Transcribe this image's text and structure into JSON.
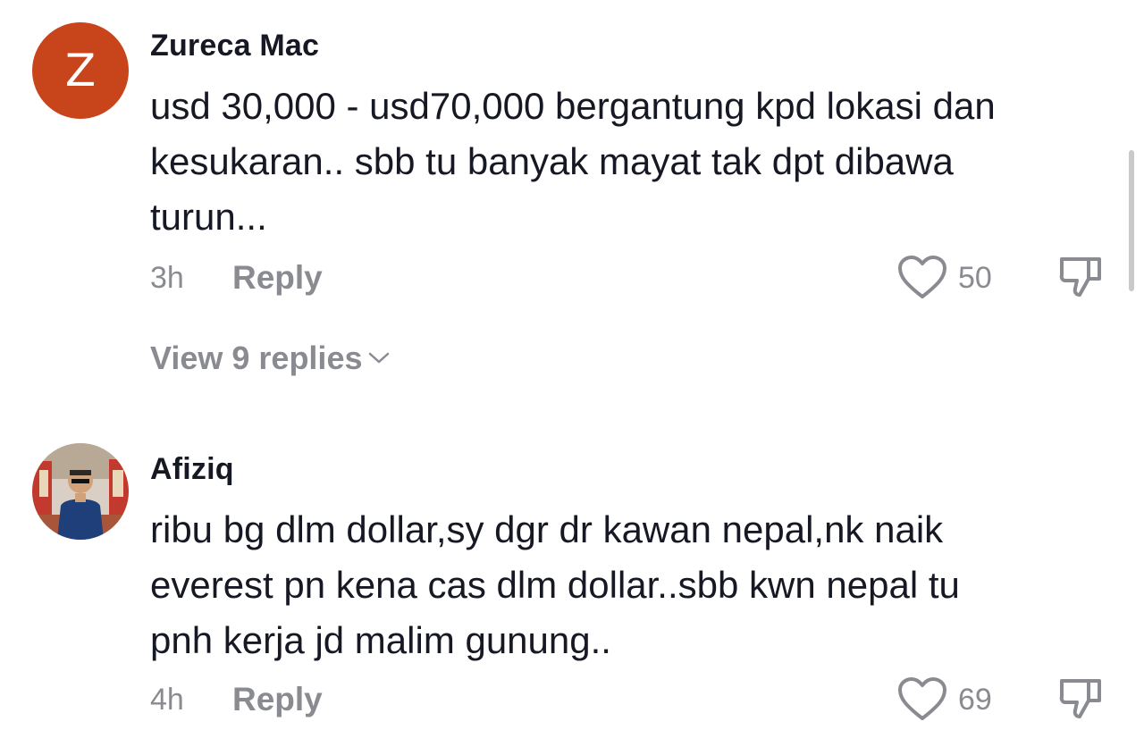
{
  "comments": [
    {
      "username": "Zureca Mac",
      "avatar_letter": "Z",
      "text": "usd 30,000 - usd70,000 bergantung kpd lokasi dan\nkesukaran.. sbb tu banyak mayat tak dpt dibawa\nturun...",
      "time": "3h",
      "reply_label": "Reply",
      "likes": "50",
      "view_replies": "View 9 replies"
    },
    {
      "username": "Afiziq",
      "avatar_icon": "profile-photo",
      "text": "ribu bg dlm dollar,sy dgr dr kawan nepal,nk naik\neverest pn kena cas dlm dollar..sbb kwn nepal tu\npnh kerja jd malim gunung..",
      "time": "4h",
      "reply_label": "Reply",
      "likes": "69"
    }
  ],
  "colors": {
    "text": "#161823",
    "muted": "#8a8b91",
    "avatar_z": "#c8441b"
  }
}
